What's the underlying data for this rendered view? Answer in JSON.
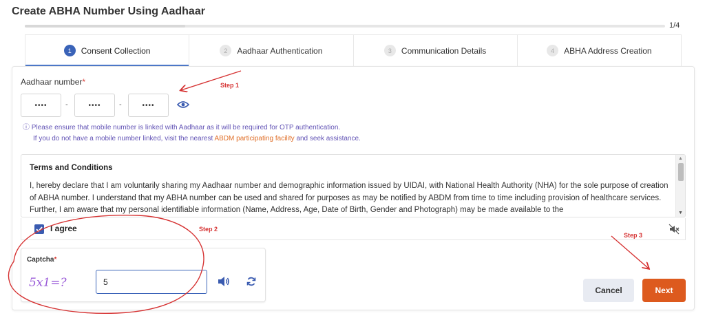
{
  "page": {
    "title": "Create ABHA Number Using Aadhaar"
  },
  "progress": {
    "label": "1/4",
    "fraction": 0.25
  },
  "steps": [
    {
      "number": "1",
      "label": "Consent Collection",
      "active": true
    },
    {
      "number": "2",
      "label": "Aadhaar Authentication",
      "active": false
    },
    {
      "number": "3",
      "label": "Communication Details",
      "active": false
    },
    {
      "number": "4",
      "label": "ABHA Address Creation",
      "active": false
    }
  ],
  "aadhaar": {
    "label": "Aadhaar number",
    "required_mark": "*",
    "segments": [
      "••••",
      "••••",
      "••••"
    ],
    "separator": "-",
    "toggle_icon": "eye-icon"
  },
  "info": {
    "icon": "ⓘ",
    "line1": "Please ensure that mobile number is linked with Aadhaar as it will be required for OTP authentication.",
    "line2_prefix": "If you do not have a mobile number linked, visit the nearest",
    "line2_link": "ABDM participating facility",
    "line2_suffix": "and seek assistance."
  },
  "terms": {
    "title": "Terms and Conditions",
    "text": "I, hereby declare that I am voluntarily sharing my Aadhaar number and demographic information issued by UIDAI, with National Health Authority (NHA) for the sole purpose of creation of ABHA number. I understand that my ABHA number can be used and shared for purposes as may be notified by ABDM from time to time including provision of healthcare services. Further, I am aware that my personal identifiable information (Name, Address, Age, Date of Birth, Gender and Photograph) may be made available to the"
  },
  "agree": {
    "label": "I agree",
    "checked": true,
    "mute_icon": "mute-icon"
  },
  "captcha": {
    "label": "Captcha",
    "required_mark": "*",
    "challenge": "5x1=?",
    "value": "5",
    "speaker_icon": "speaker-icon",
    "refresh_icon": "refresh-icon"
  },
  "buttons": {
    "cancel": "Cancel",
    "next": "Next"
  },
  "annotations": {
    "step1": "Step 1",
    "step2": "Step 2",
    "step3": "Step 3"
  },
  "colors": {
    "accent": "#3a63b8",
    "next": "#dd5a1e",
    "annotation": "#d63333",
    "info": "#6253b5",
    "link": "#e0702a"
  }
}
